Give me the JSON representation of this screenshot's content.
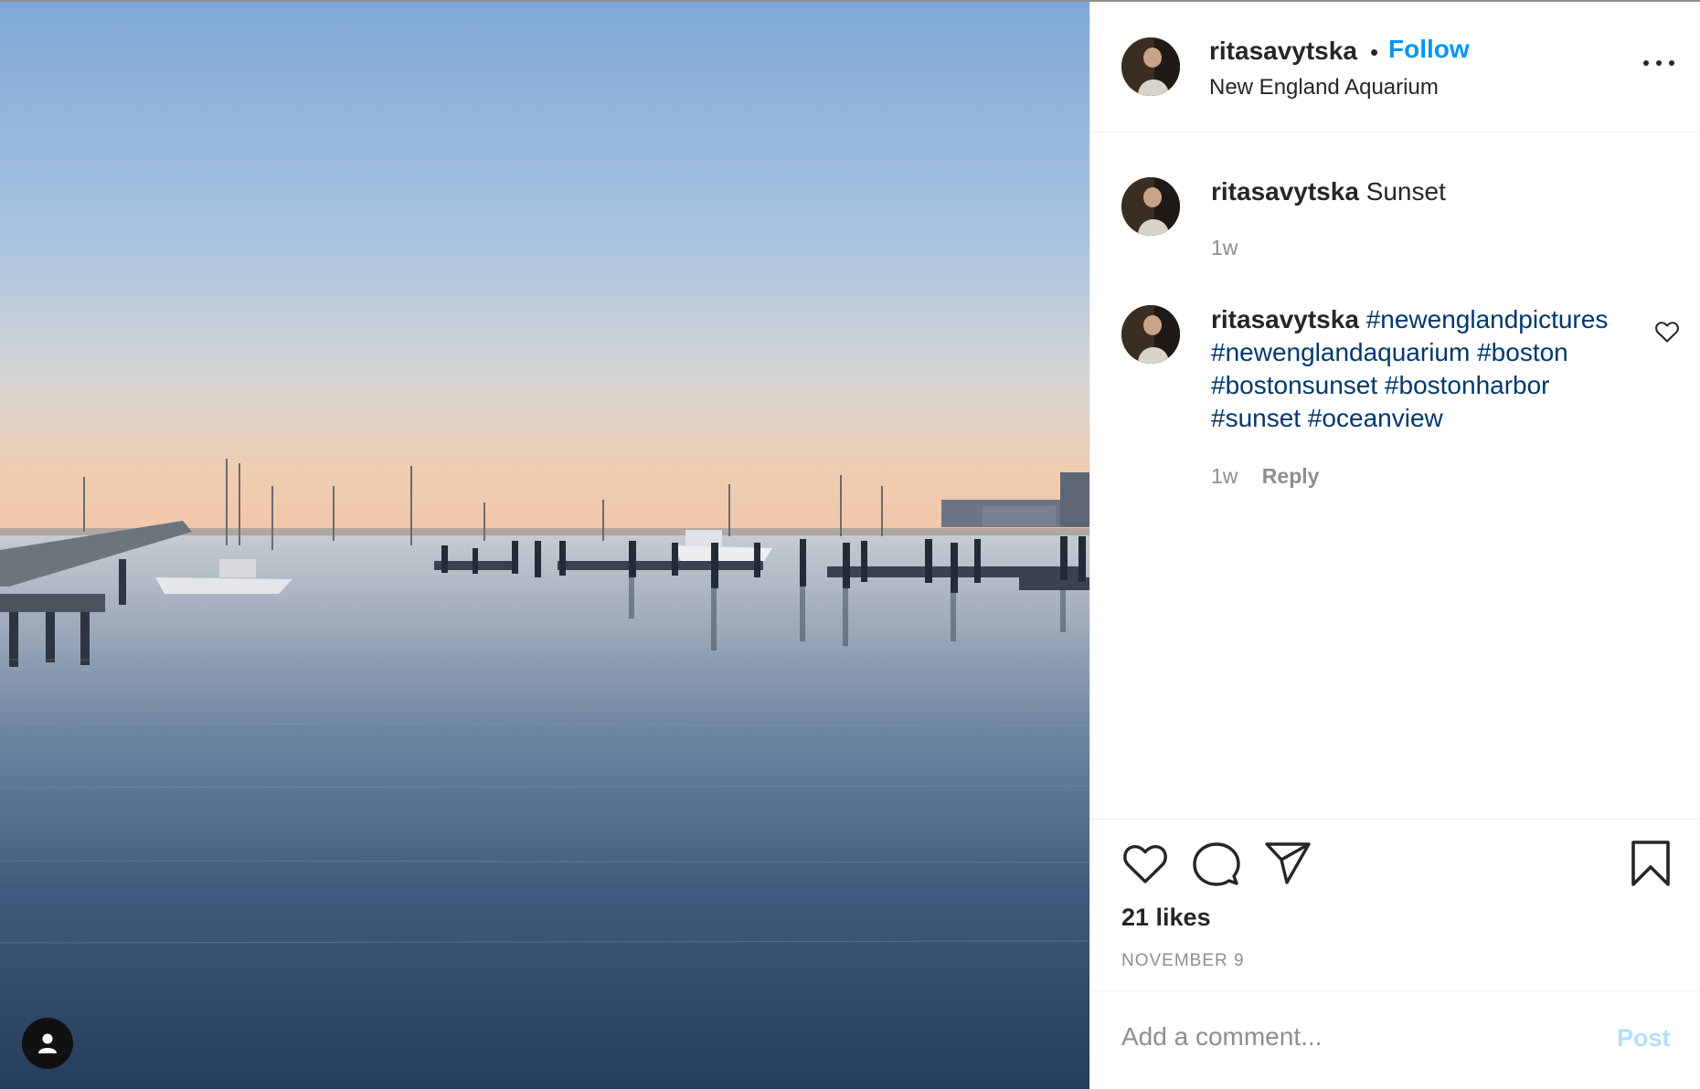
{
  "post": {
    "username": "ritasavytska",
    "separator": "•",
    "follow_label": "Follow",
    "location": "New England Aquarium",
    "more_icon": "more-horizontal-icon"
  },
  "comments": [
    {
      "username": "ritasavytska",
      "text": "Sunset",
      "time": "1w"
    },
    {
      "username": "ritasavytska",
      "hashtags": [
        "#newenglandpictures",
        "#newenglandaquarium",
        "#boston",
        "#bostonsunset",
        "#bostonharbor",
        "#sunset",
        "#oceanview"
      ],
      "time": "1w",
      "reply_label": "Reply"
    }
  ],
  "actions": {
    "icons": [
      "heart-icon",
      "comment-icon",
      "share-icon",
      "bookmark-icon"
    ],
    "likes": "21 likes",
    "date": "NOVEMBER 9"
  },
  "composer": {
    "placeholder": "Add a comment...",
    "post_label": "Post"
  },
  "colors": {
    "link_blue": "#0095f6",
    "hashtag_blue": "#00376b",
    "post_disabled": "#b2dffc",
    "muted": "#8e8e8e"
  }
}
